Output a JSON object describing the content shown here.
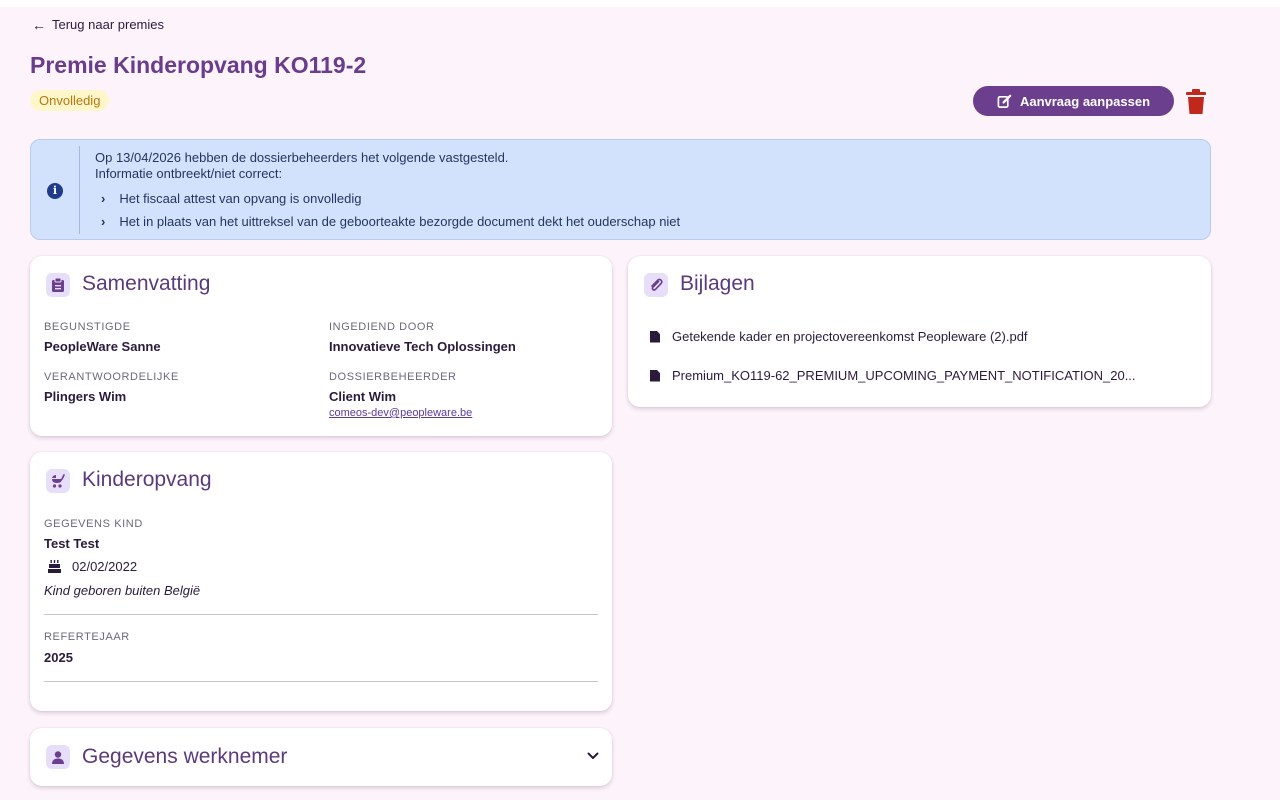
{
  "back_link": "Terug naar premies",
  "page_title": "Premie Kinderopvang KO119-2",
  "status_badge": "Onvolledig",
  "actions": {
    "edit_label": "Aanvraag aanpassen"
  },
  "alert": {
    "line1": "Op 13/04/2026 hebben de dossierbeheerders het volgende vastgesteld.",
    "line2": "Informatie ontbreekt/niet correct:",
    "items": [
      "Het fiscaal attest van opvang is onvolledig",
      "Het in plaats van het uittreksel van de geboorteakte bezorgde document dekt het ouderschap niet"
    ]
  },
  "summary": {
    "title": "Samenvatting",
    "beneficiary_label": "BEGUNSTIGDE",
    "beneficiary": "PeopleWare Sanne",
    "submitted_by_label": "INGEDIEND DOOR",
    "submitted_by": "Innovatieve Tech Oplossingen",
    "responsible_label": "VERANTWOORDELIJKE",
    "responsible": "Plingers Wim",
    "file_manager_label": "DOSSIERBEHEERDER",
    "file_manager": "Client Wim",
    "file_manager_email": "comeos-dev@peopleware.be"
  },
  "childcare": {
    "title": "Kinderopvang",
    "child_label": "GEGEVENS KIND",
    "child_name": "Test Test",
    "birth_date": "02/02/2022",
    "birth_note": "Kind geboren buiten België",
    "ref_year_label": "REFERTEJAAR",
    "ref_year": "2025"
  },
  "employee": {
    "title": "Gegevens werknemer"
  },
  "attachments": {
    "title": "Bijlagen",
    "files": [
      "Getekende kader en projectovereenkomst Peopleware (2).pdf",
      "Premium_KO119-62_PREMIUM_UPCOMING_PAYMENT_NOTIFICATION_20..."
    ]
  },
  "colors": {
    "accent": "#6c3f8e",
    "title": "#6a3d8c",
    "alert_bg": "#d3e2fc",
    "delete": "#c0281c"
  },
  "icons": {
    "back": "arrow-left-icon",
    "edit": "edit-icon",
    "delete": "trash-icon",
    "info": "info-icon",
    "summary": "clipboard-icon",
    "childcare": "stroller-icon",
    "employee": "user-icon",
    "attachments": "paperclip-icon",
    "file": "file-icon",
    "birthday": "birthday-cake-icon",
    "expand": "chevron-down-icon"
  }
}
